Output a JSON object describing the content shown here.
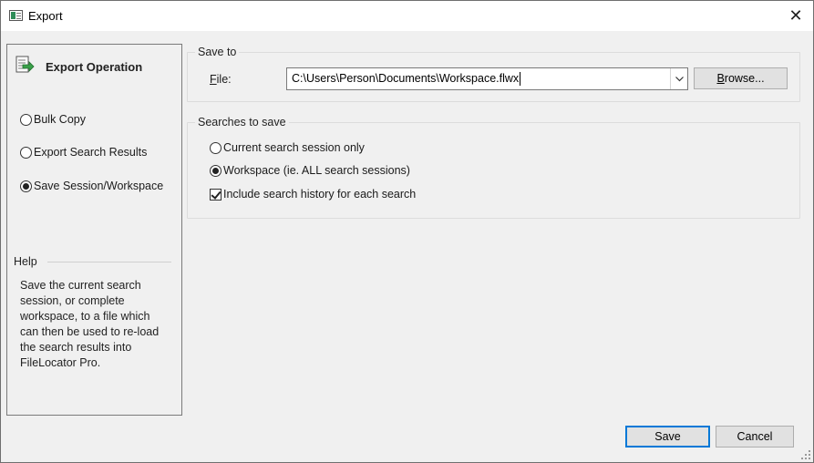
{
  "window": {
    "title": "Export",
    "close_glyph": "✕"
  },
  "left_panel": {
    "header": {
      "icon": "export-document-arrow-icon",
      "title": "Export Operation"
    },
    "operations": [
      {
        "label": "Bulk Copy",
        "checked": false
      },
      {
        "label": "Export Search Results",
        "checked": false
      },
      {
        "label": "Save Session/Workspace",
        "checked": true
      }
    ],
    "help": {
      "title": "Help",
      "lines": [
        "Save the current search",
        "session, or complete",
        "workspace, to a file which",
        "can then be used to re-load",
        "the search results into",
        "FileLocator Pro."
      ]
    }
  },
  "save_to": {
    "group_label": "Save to",
    "file_label_underlined": "F",
    "file_label_rest": "ile:",
    "file_value": "C:\\Users\\Person\\Documents\\Workspace.flwx",
    "browse_label_underlined": "B",
    "browse_label_rest": "rowse..."
  },
  "searches_to_save": {
    "group_label": "Searches to save",
    "options": [
      {
        "label": "Current search session only",
        "checked": false
      },
      {
        "label": "Workspace (ie. ALL search sessions)",
        "checked": true
      }
    ],
    "include_history": {
      "label": "Include search history for each search",
      "checked": true
    }
  },
  "footer": {
    "save_label": "Save",
    "cancel_label": "Cancel"
  },
  "colors": {
    "accent": "#0078d7",
    "dialog_bg": "#f0f0f0"
  }
}
